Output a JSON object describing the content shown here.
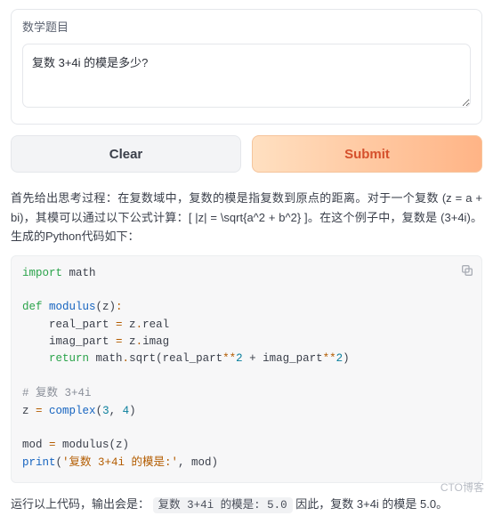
{
  "input": {
    "label": "数学题目",
    "value": "复数 3+4i 的模是多少?"
  },
  "buttons": {
    "clear": "Clear",
    "submit": "Submit"
  },
  "output": {
    "thought": "首先给出思考过程：在复数域中，复数的模是指复数到原点的距离。对于一个复数 (z = a + bi)，其模可以通过以下公式计算：[ |z| = \\sqrt{a^2 + b^2} ]。在这个例子中，复数是 (3+4i)。生成的Python代码如下：",
    "code": {
      "l01a": "import",
      "l01b": " math",
      "l03a": "def",
      "l03b": " modulus",
      "l03c": "(z)",
      "l03d": ":",
      "l04a": "    real_part ",
      "l04b": "=",
      "l04c": " z",
      "l04d": ".",
      "l04e": "real",
      "l05a": "    imag_part ",
      "l05b": "=",
      "l05c": " z",
      "l05d": ".",
      "l05e": "imag",
      "l06a": "    ",
      "l06b": "return",
      "l06c": " math",
      "l06d": ".",
      "l06e": "sqrt(real_part",
      "l06f": "**",
      "l06g": "2",
      "l06h": " + imag_part",
      "l06i": "**",
      "l06j": "2",
      "l06k": ")",
      "l08": "# 复数 3+4i",
      "l09a": "z ",
      "l09b": "=",
      "l09c": " ",
      "l09d": "complex",
      "l09e": "(",
      "l09f": "3",
      "l09g": ", ",
      "l09h": "4",
      "l09i": ")",
      "l11a": "mod ",
      "l11b": "=",
      "l11c": " modulus(z)",
      "l12a": "print",
      "l12b": "(",
      "l12c": "'复数 3+4i 的模是:'",
      "l12d": ", mod)"
    },
    "conclusion_pre": "运行以上代码，输出会是：",
    "conclusion_code": "复数 3+4i 的模是: 5.0",
    "conclusion_post": " 因此，复数 3+4i 的模是 5.0。"
  },
  "watermark": "CTO博客"
}
